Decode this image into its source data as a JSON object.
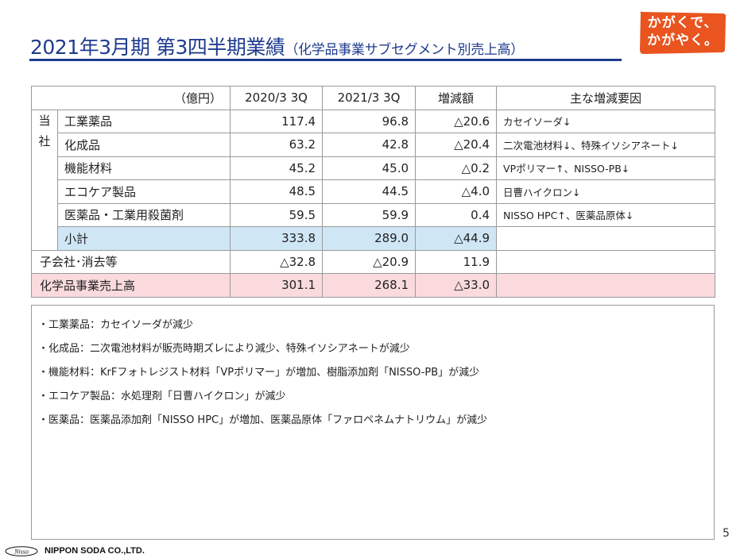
{
  "header": {
    "title_main": "2021年3月期 第3四半期業績",
    "title_sub": "（化学品事業サブセグメント別売上高）",
    "logo_line1": "かがくで、",
    "logo_line2": "かがやく。"
  },
  "table": {
    "headers": [
      "（億円）",
      "2020/3 3Q",
      "2021/3 3Q",
      "増減額",
      "主な増減要因"
    ],
    "group_label": "当社",
    "rows": [
      {
        "name": "工業薬品",
        "v1": "117.4",
        "v2": "96.8",
        "diff": "△20.6",
        "factor": "カセイソーダ↓"
      },
      {
        "name": "化成品",
        "v1": "63.2",
        "v2": "42.8",
        "diff": "△20.4",
        "factor": "二次電池材料↓、特殊イソシアネート↓"
      },
      {
        "name": "機能材料",
        "v1": "45.2",
        "v2": "45.0",
        "diff": "△0.2",
        "factor": "VPポリマー↑、NISSO-PB↓"
      },
      {
        "name": "エコケア製品",
        "v1": "48.5",
        "v2": "44.5",
        "diff": "△4.0",
        "factor": "日曹ハイクロン↓"
      },
      {
        "name": "医薬品・工業用殺菌剤",
        "v1": "59.5",
        "v2": "59.9",
        "diff": "0.4",
        "factor": "NISSO HPC↑、医薬品原体↓"
      }
    ],
    "subtotal": {
      "name": "小計",
      "v1": "333.8",
      "v2": "289.0",
      "diff": "△44.9",
      "factor": ""
    },
    "subsidiaries": {
      "name": "子会社･消去等",
      "v1": "△32.8",
      "v2": "△20.9",
      "diff": "11.9",
      "factor": ""
    },
    "total": {
      "name": "化学品事業売上高",
      "v1": "301.1",
      "v2": "268.1",
      "diff": "△33.0",
      "factor": ""
    }
  },
  "notes": [
    "・工業薬品：カセイソーダが減少",
    "・化成品：二次電池材料が販売時期ズレにより減少、特殊イソシアネートが減少",
    "・機能材料：KrFフォトレジスト材料「VPポリマー」が増加、樹脂添加剤「NISSO-PB」が減少",
    "・エコケア製品：水処理剤「日曹ハイクロン」が減少",
    "・医薬品：医薬品添加剤「NISSO HPC」が増加、医薬品原体「ファロペネムナトリウム」が減少"
  ],
  "footer": {
    "page": "5",
    "company": "NIPPON SODA CO.,LTD.",
    "mark_text": "Nisso"
  },
  "colors": {
    "title": "#1f3b8f",
    "logo_bg": "#e9541f",
    "subtotal_bg": "#cfe6f5",
    "total_bg": "#fadadd"
  }
}
